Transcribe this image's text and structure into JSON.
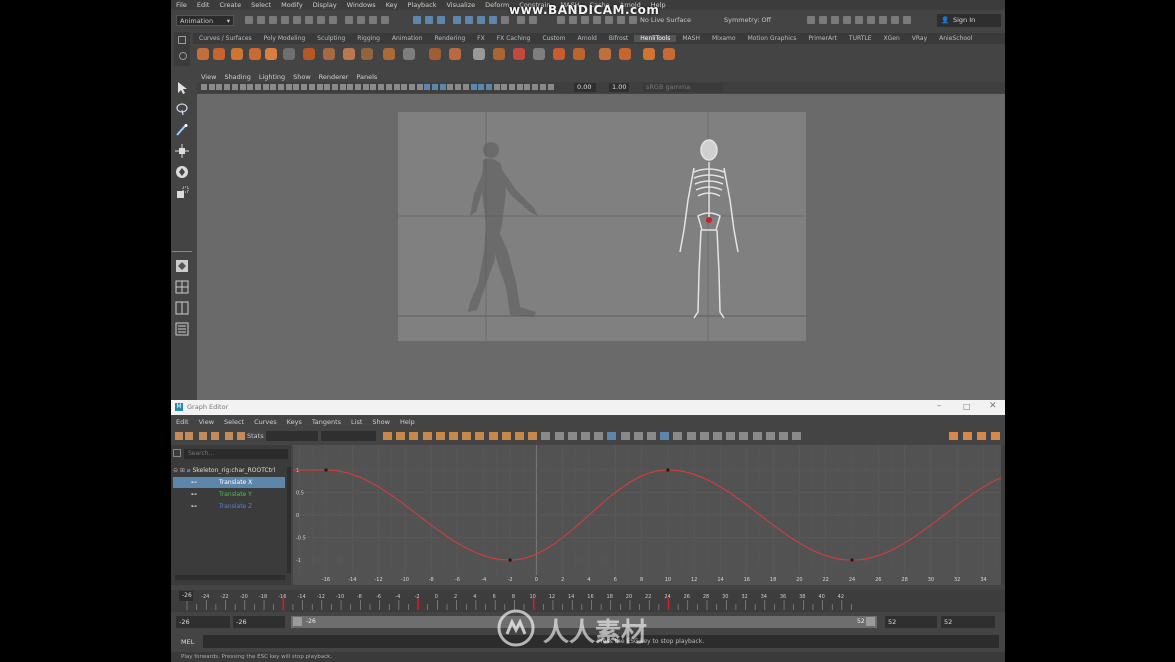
{
  "watermark": "www.BANDICAM.com",
  "logo_watermark": "人人素材",
  "menubar": [
    "File",
    "Edit",
    "Create",
    "Select",
    "Modify",
    "Display",
    "Windows",
    "Key",
    "Playback",
    "Visualize",
    "Deform",
    "Constrain",
    "MASH",
    "Cache",
    "Arnold",
    "Help"
  ],
  "status_line": {
    "mode": "Animation",
    "live_surface": "No Live Surface",
    "symmetry": "Symmetry: Off",
    "sign_in": "Sign In"
  },
  "shelf_tabs": [
    "Curves / Surfaces",
    "Poly Modeling",
    "Sculpting",
    "Rigging",
    "Animation",
    "Rendering",
    "FX",
    "FX Caching",
    "Custom",
    "Arnold",
    "Bifrost",
    "HenliTools",
    "MASH",
    "Mixamo",
    "Motion Graphics",
    "PrimerArt",
    "TURTLE",
    "XGen",
    "VRay",
    "AnieSchool"
  ],
  "shelf_active_tab": "HenliTools",
  "viewport_menu": [
    "View",
    "Shading",
    "Lighting",
    "Show",
    "Renderer",
    "Panels"
  ],
  "viewport_toolbar": {
    "exposure": "0.00",
    "gamma": "1.00",
    "color_space": "sRGB gamma"
  },
  "graph_editor": {
    "title": "Graph Editor",
    "menu": [
      "Edit",
      "View",
      "Select",
      "Curves",
      "Keys",
      "Tangents",
      "List",
      "Show",
      "Help"
    ],
    "stats_label": "Stats",
    "search_placeholder": "Search...",
    "node": "Skeleton_rig:char_ROOTCtrl",
    "channels": [
      {
        "name": "Translate X",
        "color": "#e05050",
        "selected": true
      },
      {
        "name": "Translate Y",
        "color": "#50c050",
        "selected": false
      },
      {
        "name": "Translate Z",
        "color": "#5080e0",
        "selected": false
      }
    ],
    "x_ticks": [
      "-16",
      "-14",
      "-12",
      "-10",
      "-8",
      "-6",
      "-4",
      "-2",
      "0",
      "2",
      "4",
      "6",
      "8",
      "10",
      "12",
      "14",
      "16",
      "18",
      "20",
      "22",
      "24",
      "26",
      "28",
      "30",
      "32",
      "34"
    ],
    "y_ticks": [
      "1",
      "0.5",
      "0",
      "-0.5",
      "-1"
    ],
    "curve": {
      "key_frames": [
        -16,
        -2,
        10,
        24
      ],
      "key_values": [
        1,
        -1,
        1,
        -1
      ],
      "color": "#e03a3a"
    }
  },
  "time_slider": {
    "ticks": [
      "-26",
      "-24",
      "-22",
      "-20",
      "-18",
      "-16",
      "-14",
      "-12",
      "-10",
      "-8",
      "-6",
      "-4",
      "-2",
      "0",
      "2",
      "4",
      "6",
      "8",
      "10",
      "12",
      "14",
      "16",
      "18",
      "20",
      "22",
      "24",
      "26",
      "28",
      "30",
      "32",
      "34",
      "36",
      "38",
      "40",
      "42"
    ],
    "current_frame": "-26",
    "key_frames": [
      -16,
      -2,
      10,
      24
    ]
  },
  "range_slider": {
    "start": "-26",
    "anim_start": "-26",
    "range_start_label": "-26",
    "range_end_label": "52",
    "anim_end": "52",
    "end": "52"
  },
  "command_line": {
    "label": "MEL",
    "response": "Press the ESC key to stop playback."
  },
  "help_line": "Play forwards. Pressing the ESC key will stop playback.",
  "colors": {
    "accent": "#5d86ad",
    "curve": "#e03a3a",
    "key": "#cc2222"
  }
}
